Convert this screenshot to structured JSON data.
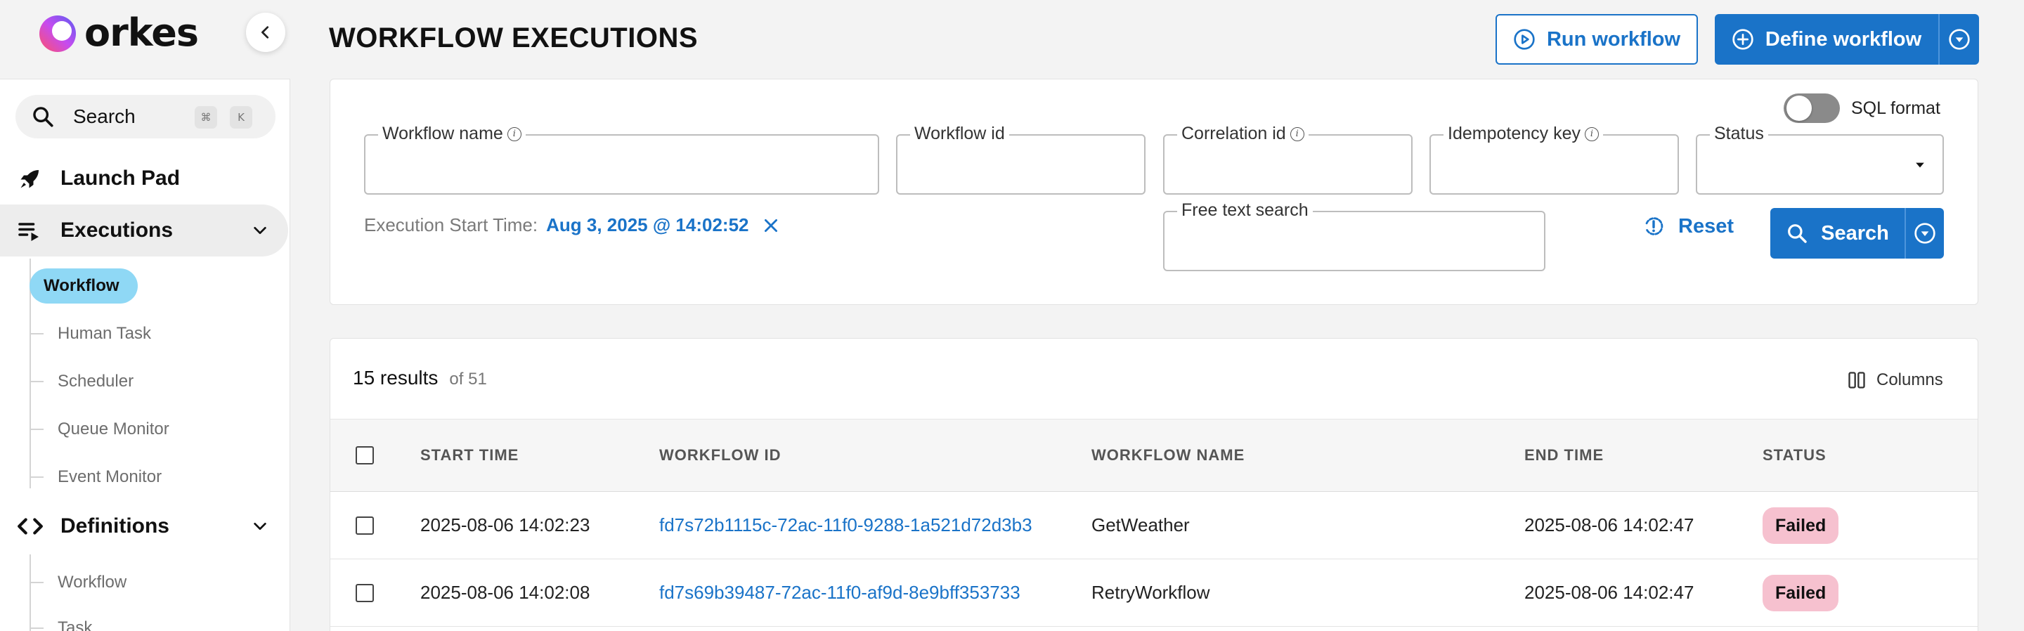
{
  "brand": {
    "name": "orkes"
  },
  "header": {
    "title": "WORKFLOW EXECUTIONS",
    "run_workflow": "Run workflow",
    "define_workflow": "Define workflow"
  },
  "sidebar": {
    "search": {
      "label": "Search",
      "shortcut_cmd": "⌘",
      "shortcut_key": "K"
    },
    "launch_pad": "Launch Pad",
    "executions": {
      "label": "Executions",
      "items": [
        "Workflow",
        "Human Task",
        "Scheduler",
        "Queue Monitor",
        "Event Monitor"
      ]
    },
    "definitions": {
      "label": "Definitions",
      "items": [
        "Workflow",
        "Task"
      ]
    }
  },
  "filters": {
    "workflow_name": "Workflow name",
    "workflow_id": "Workflow id",
    "correlation_id": "Correlation id",
    "idempotency_key": "Idempotency key",
    "status": "Status",
    "free_text_search": "Free text search",
    "sql_format": "SQL format",
    "execution_start_time_label": "Execution Start Time:",
    "execution_start_time_value": "Aug 3, 2025 @ 14:02:52",
    "reset": "Reset",
    "search": "Search"
  },
  "results": {
    "count": "15 results",
    "of_total": "of 51",
    "columns_label": "Columns",
    "headers": [
      "START TIME",
      "WORKFLOW ID",
      "WORKFLOW NAME",
      "END TIME",
      "STATUS"
    ],
    "rows": [
      {
        "start_time": "2025-08-06 14:02:23",
        "workflow_id": "fd7s72b1115c-72ac-11f0-9288-1a521d72d3b3",
        "workflow_name": "GetWeather",
        "end_time": "2025-08-06 14:02:47",
        "status": "Failed"
      },
      {
        "start_time": "2025-08-06 14:02:08",
        "workflow_id": "fd7s69b39487-72ac-11f0-af9d-8e9bff353733",
        "workflow_name": "RetryWorkflow",
        "end_time": "2025-08-06 14:02:47",
        "status": "Failed"
      }
    ]
  },
  "colors": {
    "accent": "#1a73c8",
    "active_nav": "#8fd8f5",
    "failed_badge": "#f6c1cf"
  }
}
